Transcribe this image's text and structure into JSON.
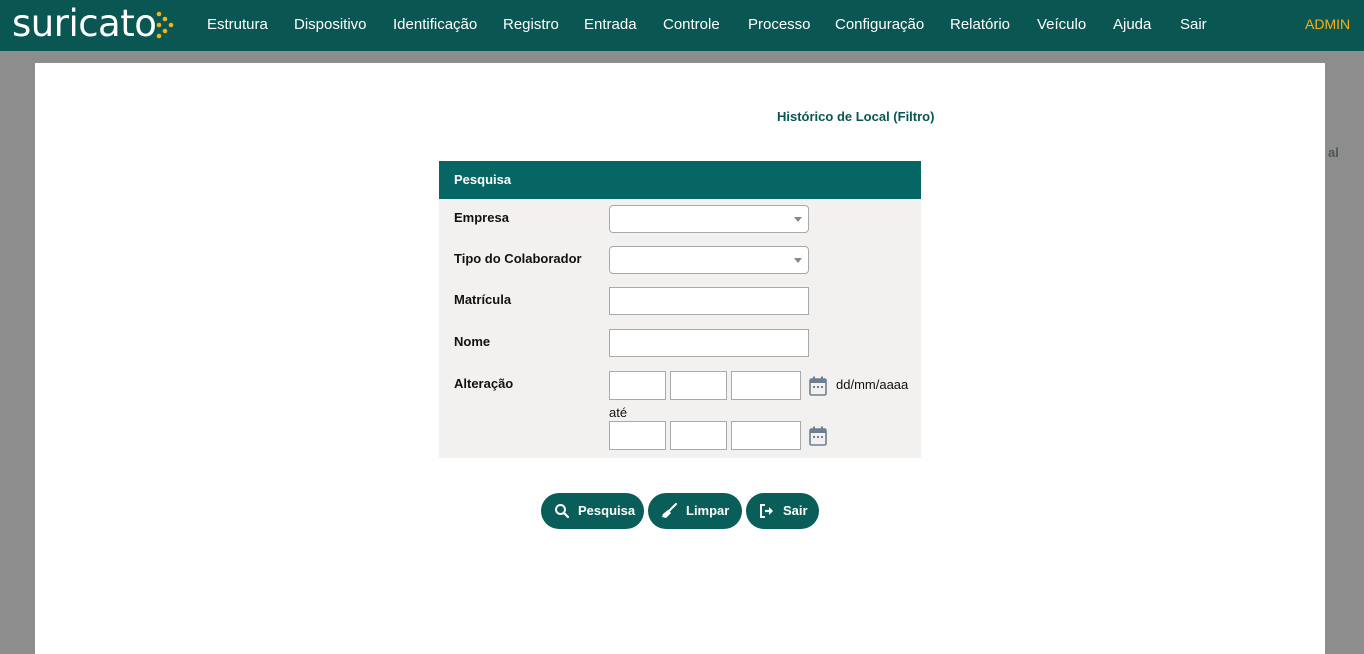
{
  "app": {
    "logo_text": "suricato",
    "user": "ADMIN"
  },
  "nav": {
    "items": [
      {
        "label": "Estrutura"
      },
      {
        "label": "Dispositivo"
      },
      {
        "label": "Identificação"
      },
      {
        "label": "Registro"
      },
      {
        "label": "Entrada"
      },
      {
        "label": "Controle"
      },
      {
        "label": "Processo"
      },
      {
        "label": "Configuração"
      },
      {
        "label": "Relatório"
      },
      {
        "label": "Veículo"
      },
      {
        "label": "Ajuda"
      },
      {
        "label": "Sair"
      }
    ]
  },
  "background": {
    "partial_text": "al"
  },
  "page": {
    "title": "Histórico de Local (Filtro)"
  },
  "panel": {
    "header": "Pesquisa",
    "fields": {
      "empresa": {
        "label": "Empresa",
        "value": ""
      },
      "tipo_colaborador": {
        "label": "Tipo do Colaborador",
        "value": ""
      },
      "matricula": {
        "label": "Matrícula",
        "value": ""
      },
      "nome": {
        "label": "Nome",
        "value": ""
      },
      "alteracao": {
        "label": "Alteração",
        "format_hint": "dd/mm/aaaa",
        "range_separator": "até"
      }
    }
  },
  "buttons": {
    "search": "Pesquisa",
    "clear": "Limpar",
    "exit": "Sair"
  },
  "colors": {
    "nav_bg": "#0a5652",
    "accent": "#066664",
    "user": "#f4b21a",
    "logo_dots": "#f4b21a"
  }
}
